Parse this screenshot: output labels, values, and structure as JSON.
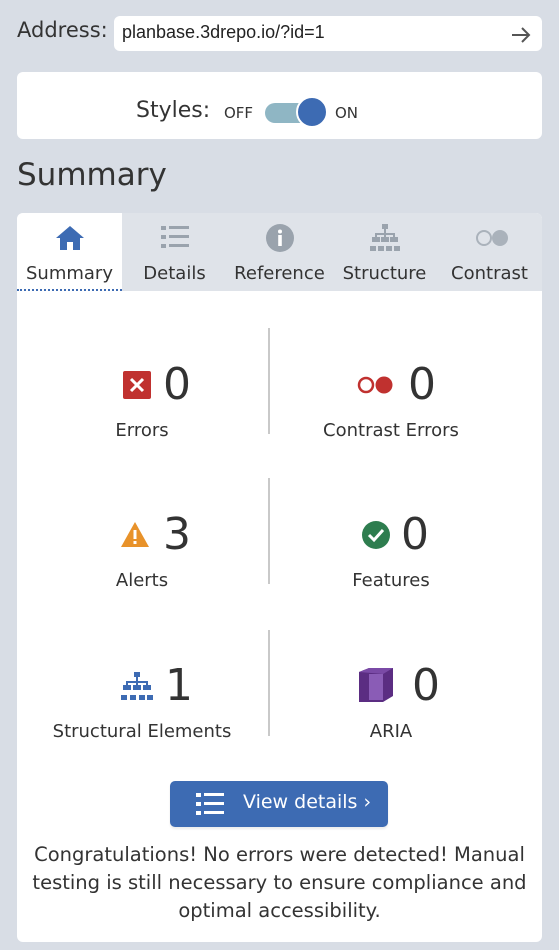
{
  "address": {
    "label": "Address:",
    "value": "planbase.3drepo.io/?id=1",
    "go_icon": "arrow-right-icon"
  },
  "styles": {
    "label": "Styles:",
    "off_label": "OFF",
    "on_label": "ON",
    "state": "on"
  },
  "page_title": "Summary",
  "tabs": [
    {
      "label": "Summary",
      "icon": "home-icon",
      "active": true
    },
    {
      "label": "Details",
      "icon": "list-icon",
      "active": false
    },
    {
      "label": "Reference",
      "icon": "info-icon",
      "active": false
    },
    {
      "label": "Structure",
      "icon": "hierarchy-icon",
      "active": false
    },
    {
      "label": "Contrast",
      "icon": "contrast-icon",
      "active": false
    }
  ],
  "stats": {
    "errors": {
      "count": "0",
      "label": "Errors",
      "icon": "error-x-icon",
      "color": "#c0312f"
    },
    "contrast_errors": {
      "count": "0",
      "label": "Contrast Errors",
      "icon": "contrast-icon",
      "color": "#c0312f"
    },
    "alerts": {
      "count": "3",
      "label": "Alerts",
      "icon": "warning-triangle-icon",
      "color": "#e8922a"
    },
    "features": {
      "count": "0",
      "label": "Features",
      "icon": "check-circle-icon",
      "color": "#2e7d4f"
    },
    "structural": {
      "count": "1",
      "label": "Structural Elements",
      "icon": "hierarchy-icon",
      "color": "#3d6bb3"
    },
    "aria": {
      "count": "0",
      "label": "ARIA",
      "icon": "aria-cube-icon",
      "color": "#5b2d82"
    }
  },
  "view_details_button": {
    "label": "View details ›",
    "icon": "list-icon"
  },
  "message": "Congratulations! No errors were detected! Manual testing is still necessary to ensure compliance and optimal accessibility.",
  "colors": {
    "accent": "#3d6bb3",
    "background": "#d8dde5",
    "toggle_track": "#8fb6c4"
  }
}
